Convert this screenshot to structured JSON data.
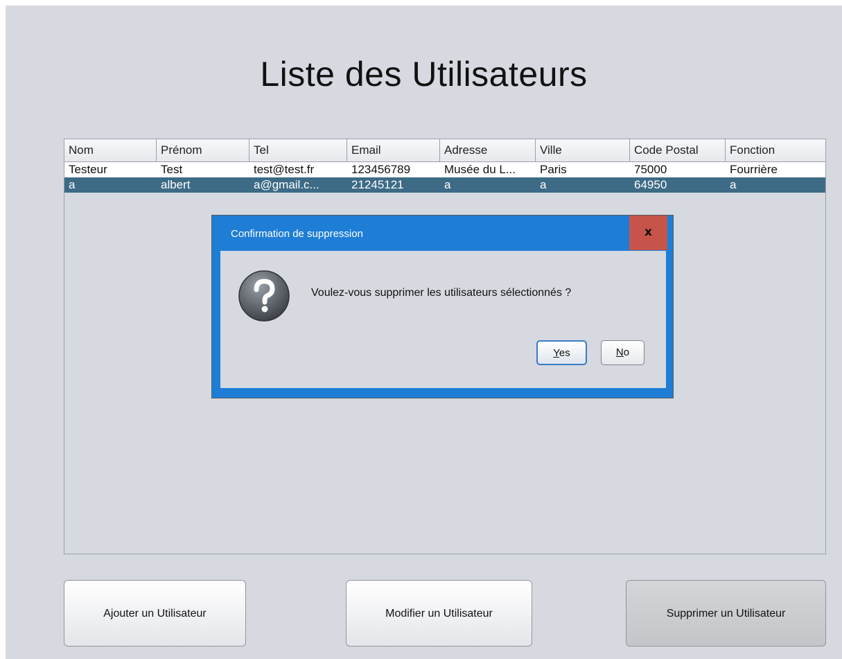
{
  "page": {
    "title": "Liste des Utilisateurs"
  },
  "table": {
    "columns": [
      "Nom",
      "Prénom",
      "Tel",
      "Email",
      "Adresse",
      "Ville",
      "Code Postal",
      "Fonction"
    ],
    "rows": [
      {
        "cells": [
          "Testeur",
          "Test",
          "test@test.fr",
          "123456789",
          "Musée du L...",
          "Paris",
          "75000",
          "Fourrière"
        ],
        "selected": false
      },
      {
        "cells": [
          "a",
          "albert",
          "a@gmail.c...",
          "21245121",
          "a",
          "a",
          "64950",
          "a"
        ],
        "selected": true
      }
    ]
  },
  "buttons": {
    "add": "Ajouter un Utilisateur",
    "edit": "Modifier un Utilisateur",
    "delete": "Supprimer un Utilisateur"
  },
  "dialog": {
    "title": "Confirmation de suppression",
    "close": "x",
    "icon": "question-icon",
    "message": "Voulez-vous supprimer les utilisateurs sélectionnés ?",
    "yes_mnemonic": "Y",
    "yes_rest": "es",
    "no_mnemonic": "N",
    "no_rest": "o"
  },
  "colors": {
    "background": "#d6d9e0",
    "selected_row": "#3d6b86",
    "dialog_frame": "#1e7ed6",
    "close_button": "#c6544a"
  }
}
